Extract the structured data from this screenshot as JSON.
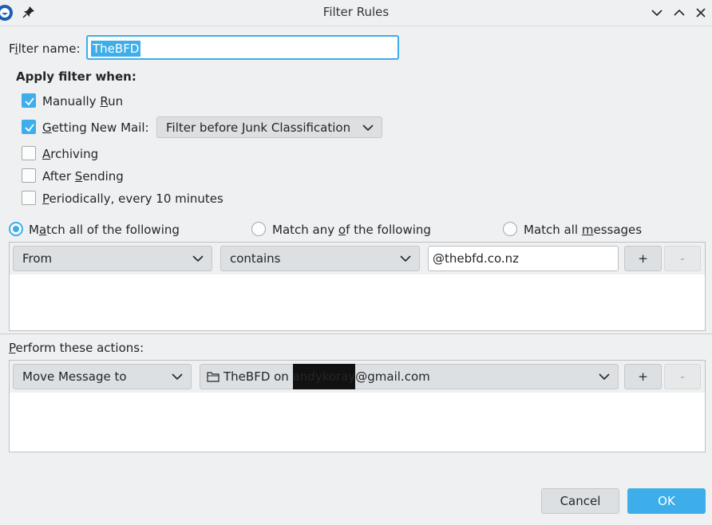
{
  "window": {
    "title": "Filter Rules",
    "icons": [
      "thunderbird-app-icon",
      "pin-icon",
      "minimize-icon",
      "maximize-icon",
      "close-icon"
    ]
  },
  "filter_name": {
    "label_pre": "F",
    "label_mnemonic": "i",
    "label_post": "lter name:",
    "value": "TheBFD"
  },
  "apply_when": {
    "heading": "Apply filter when:",
    "manually_run": {
      "pre": "Manually ",
      "mn": "R",
      "post": "un",
      "checked": true
    },
    "getting_new_mail": {
      "pre": "",
      "mn": "G",
      "post": "etting New Mail:",
      "checked": true,
      "select": "Filter before Junk Classification"
    },
    "archiving": {
      "pre": "",
      "mn": "A",
      "post": "rchiving",
      "checked": false
    },
    "after_sending": {
      "pre": "After ",
      "mn": "S",
      "post": "ending",
      "checked": false
    },
    "periodically": {
      "pre": "",
      "mn": "P",
      "post": "eriodically, every 10 minutes",
      "checked": false
    }
  },
  "match": {
    "all": {
      "pre": "M",
      "mn": "a",
      "post": "tch all of the following",
      "selected": true
    },
    "any": {
      "pre": "Match any ",
      "mn": "o",
      "post": "f the following",
      "selected": false
    },
    "messages": {
      "pre": "Match all ",
      "mn": "m",
      "post": "essages",
      "selected": false
    }
  },
  "rule": {
    "field": "From",
    "operator": "contains",
    "value": "@thebfd.co.nz",
    "add": "+",
    "remove": "-"
  },
  "actions": {
    "label_mn": "P",
    "label_post": "erform these actions:",
    "action": "Move Message to",
    "target_pre": "TheBFD on ",
    "target_redacted": "andykoray",
    "target_post": "@gmail.com",
    "add": "+",
    "remove": "-"
  },
  "buttons": {
    "cancel": "Cancel",
    "ok": "OK"
  },
  "colors": {
    "accent": "#3daee9",
    "window_bg": "#eff0f1",
    "button_bg": "#dde0e3"
  }
}
